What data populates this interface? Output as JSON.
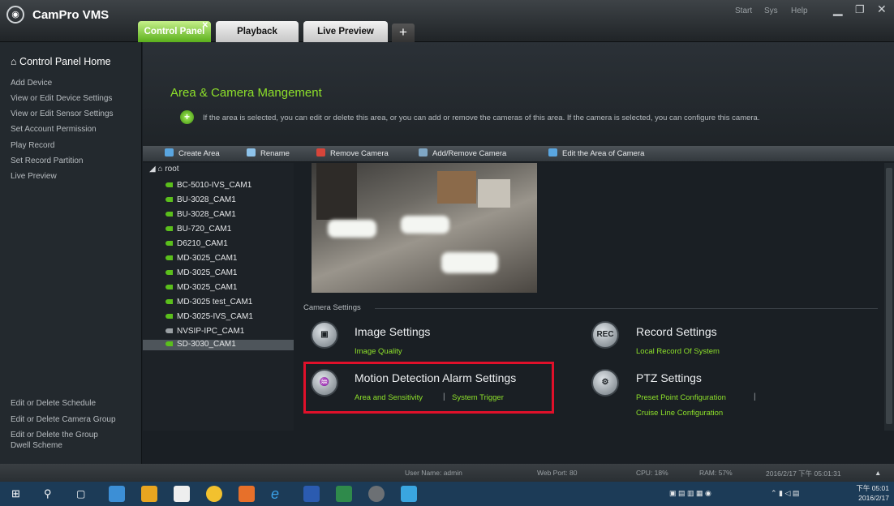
{
  "app": {
    "title": "CamPro VMS"
  },
  "window_menu": {
    "start": "Start",
    "sys": "Sys",
    "help": "Help"
  },
  "tabs": [
    {
      "label": "Control Panel",
      "active": true,
      "close": "✕"
    },
    {
      "label": "Playback",
      "active": false
    },
    {
      "label": "Live Preview",
      "active": false
    },
    {
      "label": "+",
      "active": false
    }
  ],
  "sidebar": {
    "home": "Control Panel Home",
    "items": [
      "Add Device",
      "View or Edit Device Settings",
      "View or Edit Sensor Settings",
      "Set Account Permission",
      "Play Record",
      "Set Record Partition",
      "Live Preview"
    ],
    "bottom_items": [
      "Edit or Delete Schedule",
      "Edit or Delete Camera Group",
      "Edit or Delete the Group",
      "Dwell Scheme"
    ]
  },
  "page": {
    "title": "Area & Camera Mangement",
    "info": "If the area is selected, you can edit or delete this area, or you can add or remove the cameras of this area. If the camera is selected, you can configure this camera."
  },
  "toolbar": {
    "create_area": "Create Area",
    "rename": "Rename",
    "remove_camera": "Remove Camera",
    "add_remove_camera": "Add/Remove Camera",
    "edit_area": "Edit the Area of Camera"
  },
  "tree": {
    "root": "root",
    "cameras": [
      "BC-5010-IVS_CAM1",
      "BU-3028_CAM1",
      "BU-3028_CAM1",
      "BU-720_CAM1",
      "D6210_CAM1",
      "MD-3025_CAM1",
      "MD-3025_CAM1",
      "MD-3025_CAM1",
      "MD-3025 test_CAM1",
      "MD-3025-IVS_CAM1",
      "NVSIP-IPC_CAM1",
      "SD-3030_CAM1"
    ],
    "selected_index": 11
  },
  "camera_settings": {
    "label": "Camera Settings",
    "image": {
      "title": "Image Settings",
      "links": [
        "Image Quality"
      ]
    },
    "record": {
      "title": "Record Settings",
      "links": [
        "Local Record Of System"
      ],
      "icon_text": "REC"
    },
    "motion": {
      "title": "Motion Detection Alarm Settings",
      "links": [
        "Area and Sensitivity",
        "System Trigger"
      ]
    },
    "ptz": {
      "title": "PTZ Settings",
      "links": [
        "Preset Point Configuration",
        "Cruise Line Configuration"
      ]
    }
  },
  "status": {
    "user": "User Name: admin",
    "web_port": "Web Port: 80",
    "cpu": "CPU: 18%",
    "ram": "RAM: 57%",
    "datetime": "2016/2/17 下午 05:01:31"
  },
  "taskbar": {
    "time": "下午 05:01",
    "date": "2016/2/17"
  },
  "colors": {
    "accent": "#8de02a",
    "highlight": "#e0102a"
  }
}
